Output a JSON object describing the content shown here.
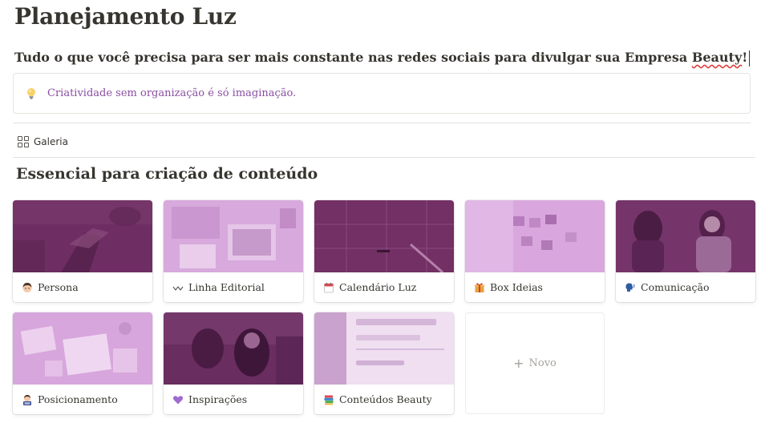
{
  "page": {
    "title": "Planejamento Luz",
    "subtitle_main": "Tudo o que você precisa para ser mais constante nas redes sociais para divulgar sua Empresa ",
    "subtitle_flagged_word": "Beauty",
    "subtitle_end": "!"
  },
  "callout": {
    "icon": "lightbulb-icon",
    "text": "Criatividade sem organização é só imaginação."
  },
  "view": {
    "icon": "gallery-grid-icon",
    "label": "Galeria"
  },
  "section": {
    "title": "Essencial para criação de conteúdo"
  },
  "colors": {
    "accent_purple": "#6b2d5e",
    "light_purple": "#c99bd0",
    "callout_text": "#8a4ea3",
    "text": "#37352f"
  },
  "cards": [
    {
      "title": "Persona",
      "icon": "woman-face-icon"
    },
    {
      "title": "Linha Editorial",
      "icon": "wave-icon"
    },
    {
      "title": "Calendário Luz",
      "icon": "calendar-icon"
    },
    {
      "title": "Box Ideias",
      "icon": "gift-icon"
    },
    {
      "title": "Comunicação",
      "icon": "speaking-head-icon"
    },
    {
      "title": "Posicionamento",
      "icon": "woman-technologist-icon"
    },
    {
      "title": "Inspirações",
      "icon": "purple-heart-icon"
    },
    {
      "title": "Conteúdos Beauty",
      "icon": "books-icon"
    }
  ],
  "new_card": {
    "label": "Novo",
    "icon": "plus-icon"
  }
}
